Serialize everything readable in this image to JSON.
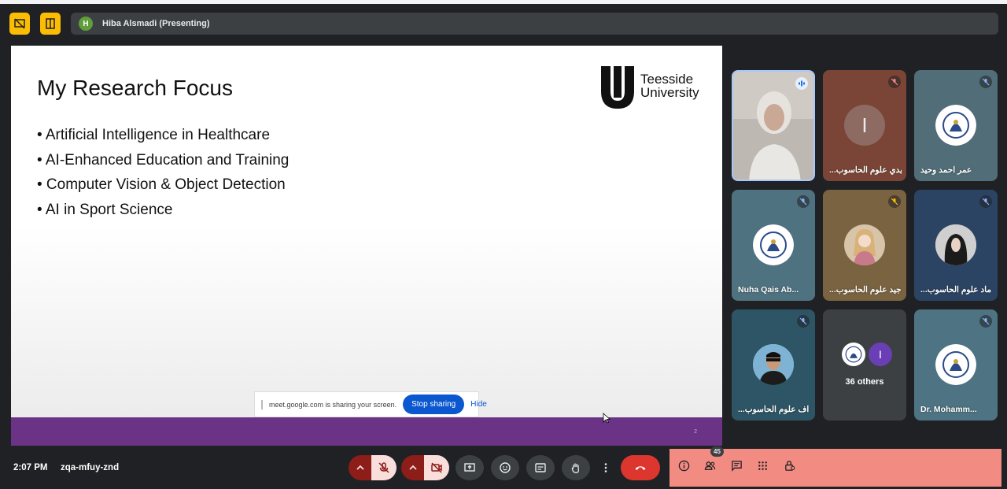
{
  "presenter": {
    "initial": "H",
    "name": "Hiba Alsmadi (Presenting)"
  },
  "slide": {
    "title": "My Research Focus",
    "bullets": [
      "• Artificial Intelligence in Healthcare",
      "• AI-Enhanced Education and Training",
      "• Computer Vision & Object Detection",
      "• AI in Sport Science"
    ],
    "logo_line1": "Teesside",
    "logo_line2": "University",
    "page_number": "2"
  },
  "share_bar": {
    "message": "meet.google.com is sharing your screen.",
    "stop_label": "Stop sharing",
    "hide_label": "Hide"
  },
  "participants": [
    {
      "name": "",
      "speaking": true,
      "mic": "speaking-icon"
    },
    {
      "name": "...يدي علوم الحاسوب /",
      "initial": "I",
      "mic": "mic-off-icon"
    },
    {
      "name": "عمر احمد وحيد",
      "mic": "mic-off-icon"
    },
    {
      "name": "Nuha Qais Ab...",
      "mic": "mic-off-icon"
    },
    {
      "name": "...جيد علوم الحاسوب /",
      "mic": "mic-off-icon"
    },
    {
      "name": "...ماد علوم الحاسوب /",
      "mic": "mic-off-icon"
    },
    {
      "name": "...اف علوم الحاسوب /",
      "mic": "mic-off-icon"
    },
    {
      "name": "",
      "others_initial": "I",
      "others_label": "36 others"
    },
    {
      "name": "Dr. Mohamm...",
      "mic": "mic-off-icon"
    }
  ],
  "footer": {
    "time": "2:07 PM",
    "meeting_code": "zqa-mfuy-znd",
    "people_count": "45"
  },
  "colors": {
    "presenting_badge": "#fbbc04",
    "slide_footer": "#6b3386",
    "hangup": "#dc362e",
    "side_panel": "#f28b82",
    "stop_sharing": "#0b57d0"
  }
}
